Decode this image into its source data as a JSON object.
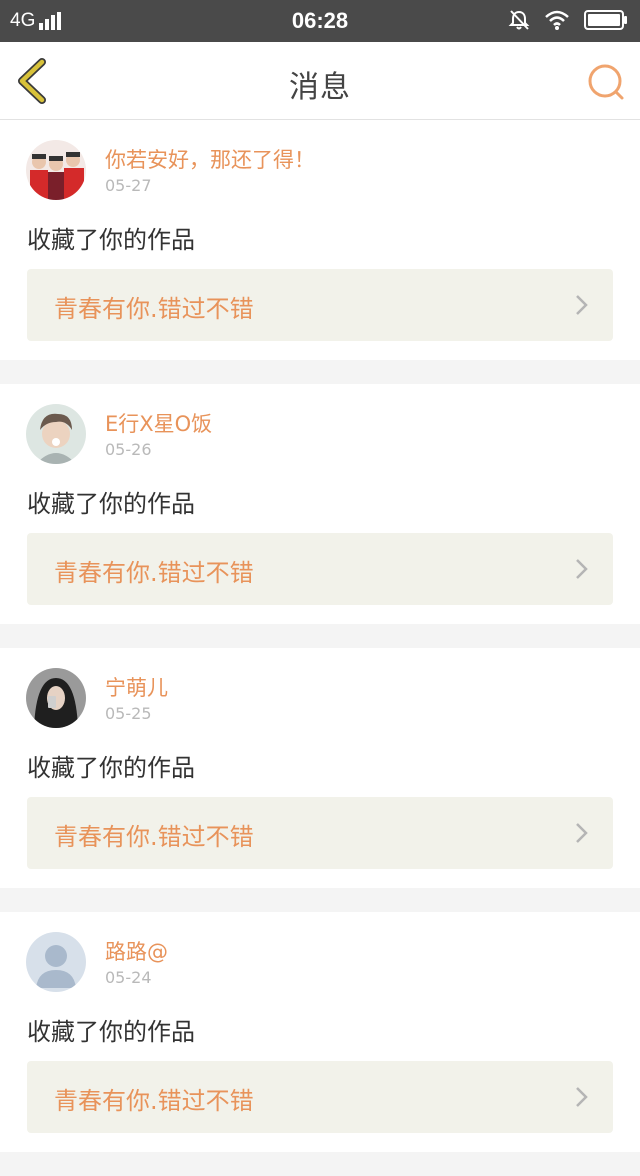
{
  "status_bar": {
    "network": "4G",
    "time": "06:28"
  },
  "nav": {
    "title": "消息",
    "back_icon": "chevron-left-icon",
    "search_icon": "search-icon"
  },
  "colors": {
    "accent": "#e8935a",
    "back_icon": "#d8c23a",
    "card_link_bg": "#f2f2ea"
  },
  "messages": [
    {
      "user": "你若安好，那还了得！",
      "date": "05-27",
      "action": "收藏了你的作品",
      "work": "青春有你.错过不错",
      "avatar": "avatar-photo-group"
    },
    {
      "user": "E行X星O饭",
      "date": "05-26",
      "action": "收藏了你的作品",
      "work": "青春有你.错过不错",
      "avatar": "avatar-photo-boy"
    },
    {
      "user": "宁萌儿",
      "date": "05-25",
      "action": "收藏了你的作品",
      "work": "青春有你.错过不错",
      "avatar": "avatar-photo-girl"
    },
    {
      "user": "路路@",
      "date": "05-24",
      "action": "收藏了你的作品",
      "work": "青春有你.错过不错",
      "avatar": "default-user-icon"
    }
  ]
}
